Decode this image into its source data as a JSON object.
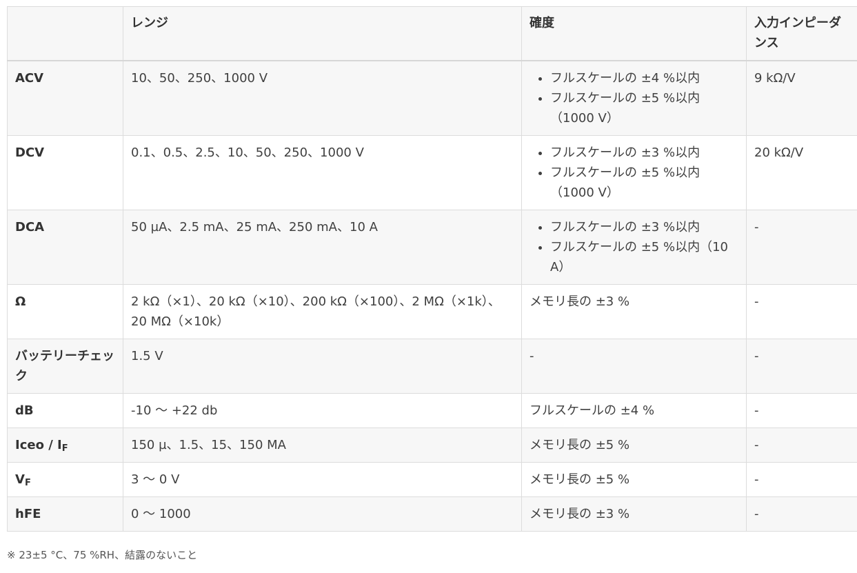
{
  "table": {
    "headers": [
      "",
      "レンジ",
      "確度",
      "入力インピーダンス"
    ],
    "rows": [
      {
        "label": "ACV",
        "range": "10、50、250、1000 V",
        "accuracy": [
          "フルスケールの ±4 %以内",
          "フルスケールの ±5 %以内（1000 V）"
        ],
        "impedance": "9 kΩ/V"
      },
      {
        "label": "DCV",
        "range": "0.1、0.5、2.5、10、50、250、1000 V",
        "accuracy": [
          "フルスケールの ±3 %以内",
          "フルスケールの ±5 %以内（1000 V）"
        ],
        "impedance": "20 kΩ/V"
      },
      {
        "label": "DCA",
        "range": "50 µA、2.5 mA、25 mA、250 mA、10 A",
        "accuracy": [
          "フルスケールの ±3 %以内",
          "フルスケールの ±5 %以内（10 A）"
        ],
        "impedance": "-"
      },
      {
        "label": "Ω",
        "range": "2 kΩ（×1）、20 kΩ（×10）、200 kΩ（×100）、2 MΩ（×1k）、20 MΩ（×10k）",
        "accuracy": "メモリ長の ±3 %",
        "impedance": "-"
      },
      {
        "label": "バッテリーチェック",
        "range": "1.5 V",
        "accuracy": "-",
        "impedance": "-"
      },
      {
        "label": "dB",
        "range": "-10 〜 +22 db",
        "accuracy": "フルスケールの ±4 %",
        "impedance": "-"
      },
      {
        "label_main": "Iceo / I",
        "label_sub": "F",
        "range": "150 µ、1.5、15、150 MA",
        "accuracy": "メモリ長の ±5 %",
        "impedance": "-"
      },
      {
        "label_main": "V",
        "label_sub": "F",
        "range": "3 〜 0 V",
        "accuracy": "メモリ長の ±5 %",
        "impedance": "-"
      },
      {
        "label": "hFE",
        "range": "0 〜 1000",
        "accuracy": "メモリ長の ±3 %",
        "impedance": "-"
      }
    ]
  },
  "footnote": "※ 23±5 °C、75 %RH、結露のないこと"
}
